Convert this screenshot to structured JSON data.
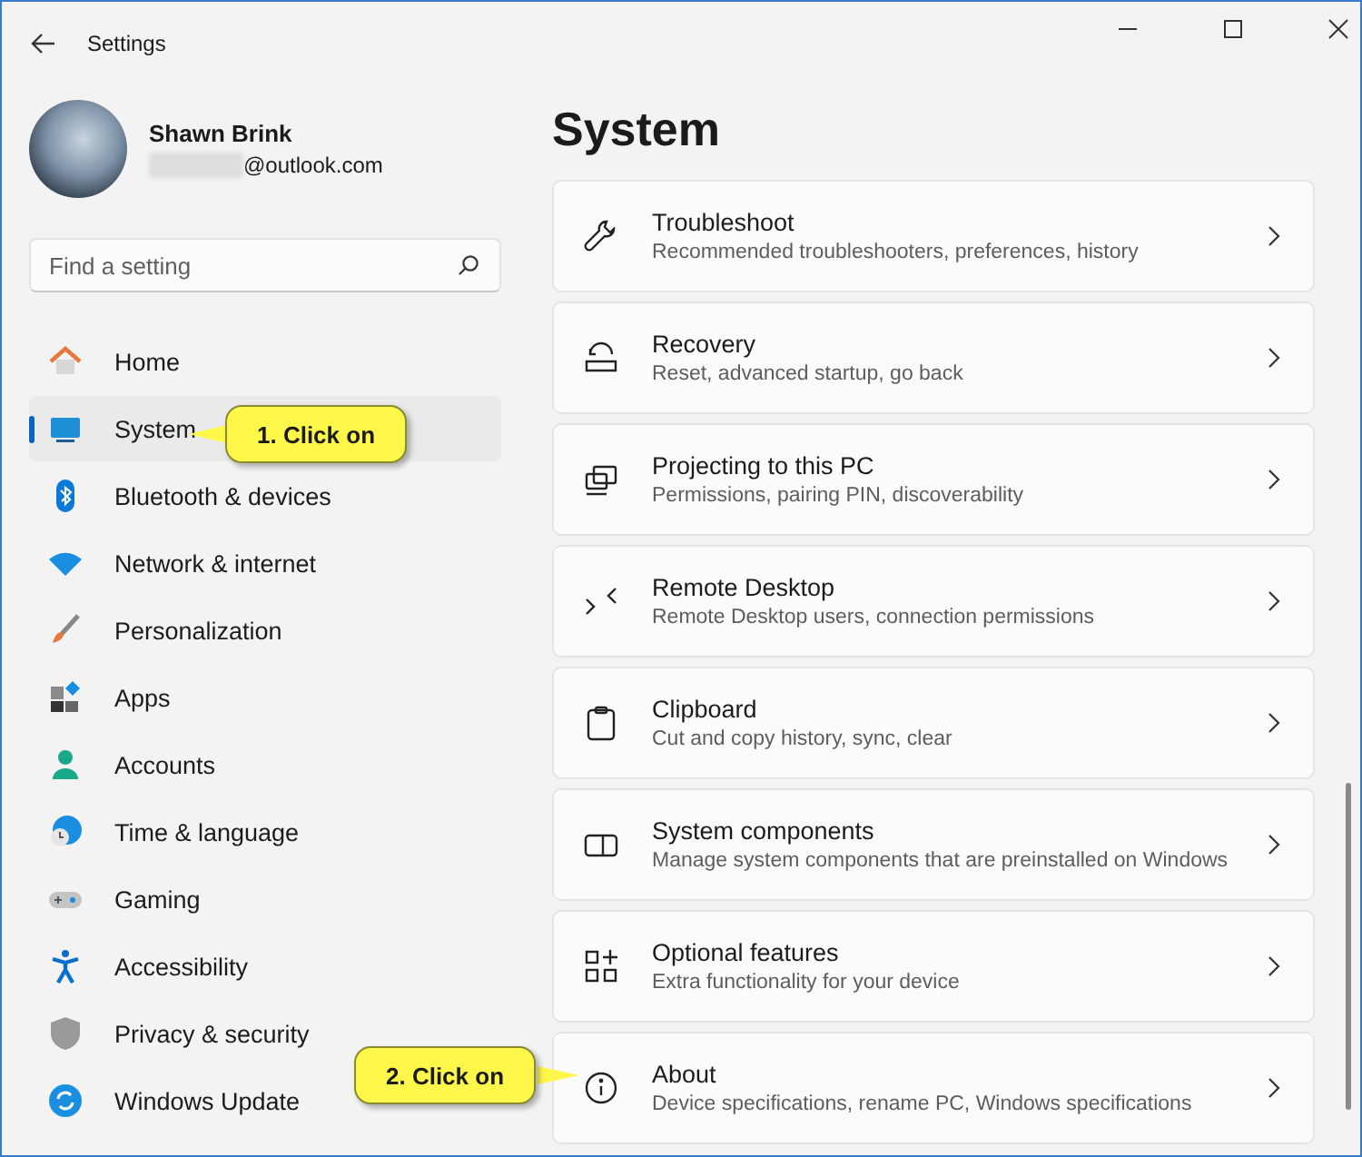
{
  "window": {
    "title": "Settings"
  },
  "account": {
    "name": "Shawn Brink",
    "email": "@outlook.com"
  },
  "search": {
    "placeholder": "Find a setting"
  },
  "nav": [
    {
      "label": "Home",
      "selected": false
    },
    {
      "label": "System",
      "selected": true
    },
    {
      "label": "Bluetooth & devices",
      "selected": false
    },
    {
      "label": "Network & internet",
      "selected": false
    },
    {
      "label": "Personalization",
      "selected": false
    },
    {
      "label": "Apps",
      "selected": false
    },
    {
      "label": "Accounts",
      "selected": false
    },
    {
      "label": "Time & language",
      "selected": false
    },
    {
      "label": "Gaming",
      "selected": false
    },
    {
      "label": "Accessibility",
      "selected": false
    },
    {
      "label": "Privacy & security",
      "selected": false
    },
    {
      "label": "Windows Update",
      "selected": false
    }
  ],
  "page": {
    "title": "System"
  },
  "cards": [
    {
      "title": "Troubleshoot",
      "description": "Recommended troubleshooters, preferences, history"
    },
    {
      "title": "Recovery",
      "description": "Reset, advanced startup, go back"
    },
    {
      "title": "Projecting to this PC",
      "description": "Permissions, pairing PIN, discoverability"
    },
    {
      "title": "Remote Desktop",
      "description": "Remote Desktop users, connection permissions"
    },
    {
      "title": "Clipboard",
      "description": "Cut and copy history, sync, clear"
    },
    {
      "title": "System components",
      "description": "Manage system components that are preinstalled on Windows"
    },
    {
      "title": "Optional features",
      "description": "Extra functionality for your device"
    },
    {
      "title": "About",
      "description": "Device specifications, rename PC, Windows specifications"
    }
  ],
  "callouts": [
    {
      "text": "1. Click on"
    },
    {
      "text": "2. Click on"
    }
  ]
}
